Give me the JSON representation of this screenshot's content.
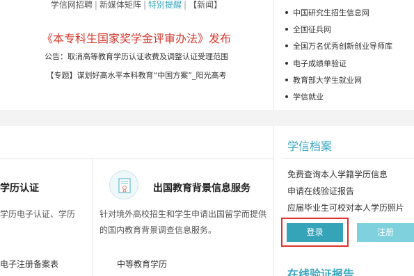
{
  "top": {
    "links": [
      {
        "label": "学信网招聘",
        "highlight": false
      },
      {
        "label": "新媒体矩阵",
        "highlight": false
      },
      {
        "label": "特别提醒",
        "highlight": true
      },
      {
        "label": "【新闻】",
        "highlight": false
      }
    ],
    "separator": "|",
    "headline": "《本专科生国家奖学金评审办法》发布",
    "notice": "公告：取消高等教育学历认证收费及调整认证受理范围",
    "special": "【专题】谋划好高水平本科教育“中国方案”_阳光高考"
  },
  "right_links": [
    "中国研究生招生信息网",
    "全国征兵网",
    "全国万名优秀创新创业导师库",
    "电子成绩单验证",
    "教育部大学生就业网",
    "学信就业"
  ],
  "cards": {
    "card1": {
      "title": "学历认证",
      "desc": "学历电子认证、学历",
      "item": "电子注册备案表"
    },
    "card2": {
      "icon": "certificate-icon",
      "title": "出国教育背景信息服务",
      "desc": "针对境外高校招生和学生申请出国留学而提供的国内教育背景调查信息服务。",
      "item": "中等教育学历"
    }
  },
  "xuexin": {
    "title": "学信档案",
    "links": [
      "免费查询本人学籍学历信息",
      "申请在线验证报告",
      "应届毕业生可校对本人学历照片"
    ],
    "login_label": "登录",
    "register_label": "注册"
  },
  "online_report": {
    "title": "在线验证报告"
  },
  "colors": {
    "accent": "#3aa8c1",
    "headline_red": "#d33a2e",
    "login": "#35a3b8",
    "register": "#7fd1de",
    "highlight_box": "#e0302c"
  }
}
